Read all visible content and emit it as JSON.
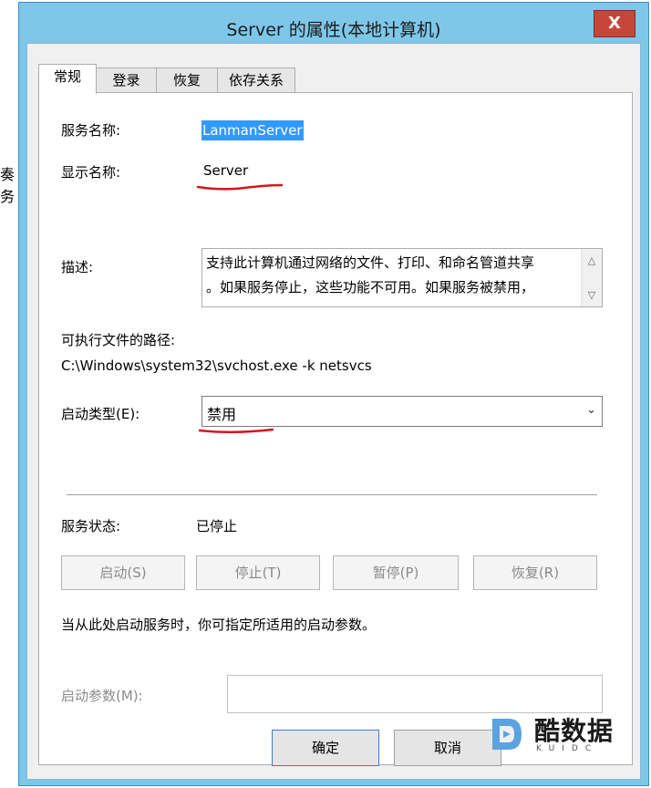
{
  "window": {
    "title": "Server 的属性(本地计算机)",
    "close_label": "X"
  },
  "tabs": [
    "常规",
    "登录",
    "恢复",
    "依存关系"
  ],
  "general": {
    "service_name_label": "服务名称:",
    "service_name": "LanmanServer",
    "display_name_label": "显示名称:",
    "display_name": "Server",
    "description_label": "描述:",
    "description_line1": "支持此计算机通过网络的文件、打印、和命名管道共享",
    "description_line2": "。如果服务停止，这些功能不可用。如果服务被禁用，",
    "exe_path_label": "可执行文件的路径:",
    "exe_path": "C:\\Windows\\system32\\svchost.exe -k netsvcs",
    "startup_type_label": "启动类型(E):",
    "startup_type": "禁用",
    "service_status_label": "服务状态:",
    "service_status": "已停止",
    "start_btn": "启动(S)",
    "stop_btn": "停止(T)",
    "pause_btn": "暂停(P)",
    "resume_btn": "恢复(R)",
    "hint": "当从此处启动服务时，你可指定所适用的启动参数。",
    "start_params_label": "启动参数(M):",
    "start_params_value": ""
  },
  "footer": {
    "ok": "确定",
    "cancel": "取消"
  },
  "watermark": {
    "text": "酷数据",
    "sub": "KUIDC"
  },
  "background_fragments": [
    "奏",
    "务"
  ],
  "colors": {
    "title_bg": "#7ec7e8",
    "close_red": "#c7463b",
    "selection_blue": "#3399ff",
    "annotation_red": "#d4161c"
  }
}
